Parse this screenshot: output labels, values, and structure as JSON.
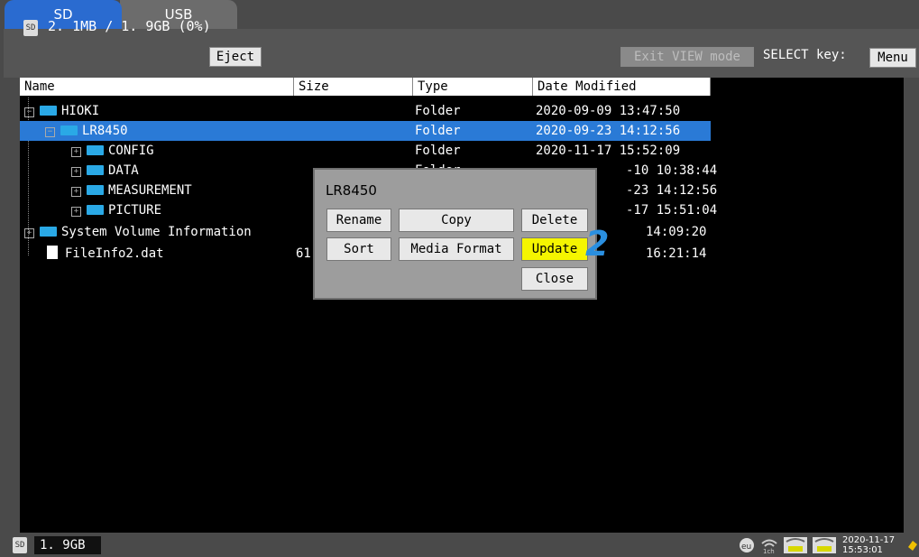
{
  "tabs": [
    {
      "label": "SD"
    },
    {
      "label": "USB"
    }
  ],
  "storage": {
    "usage": "2. 1MB / 1. 9GB (0%)",
    "eject_label": "Eject",
    "sd_icon": "SD"
  },
  "view": {
    "exit_label": "Exit VIEW mode",
    "select_key_label": "SELECT key:",
    "menu_label": "Menu"
  },
  "columns": {
    "name": "Name",
    "size": "Size",
    "type": "Type",
    "date": "Date Modified"
  },
  "rows": [
    {
      "name": "HIOKI",
      "size": "",
      "type": "Folder",
      "date": "2020-09-09 13:47:50"
    },
    {
      "name": "LR8450",
      "size": "",
      "type": "Folder",
      "date": "2020-09-23 14:12:56"
    },
    {
      "name": "CONFIG",
      "size": "",
      "type": "Folder",
      "date": "2020-11-17 15:52:09"
    },
    {
      "name": "DATA",
      "size": "",
      "type": "Folder",
      "date": "-10 10:38:44"
    },
    {
      "name": "MEASUREMENT",
      "size": "",
      "type": "",
      "date": "-23 14:12:56"
    },
    {
      "name": "PICTURE",
      "size": "",
      "type": "",
      "date": "-17 15:51:04"
    },
    {
      "name": "System Volume Information",
      "size": "",
      "type": "",
      "date": "14:09:20"
    },
    {
      "name": "FileInfo2.dat",
      "size": "61",
      "type": "",
      "date": "16:21:14"
    }
  ],
  "dialog": {
    "title": "LR8450",
    "rename": "Rename",
    "copy": "Copy",
    "delete": "Delete",
    "sort": "Sort",
    "media_format": "Media Format",
    "update": "Update",
    "close": "Close"
  },
  "step_marker": "2",
  "status": {
    "capacity": "1. 9GB",
    "date": "2020-11-17",
    "time": "15:53:01",
    "ch": "1ch"
  },
  "colors": {
    "accent": "#2a7ad6",
    "highlight": "#f5f500",
    "folder": "#2aa9e6"
  }
}
